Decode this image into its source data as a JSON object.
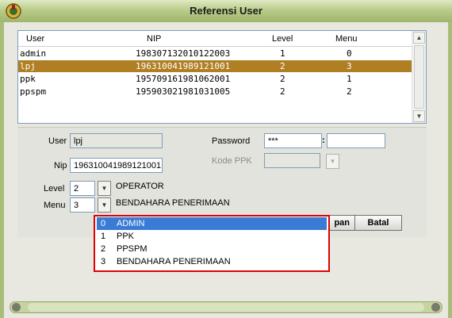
{
  "window": {
    "title": "Referensi User",
    "logo_icon": "emblem-icon"
  },
  "grid": {
    "columns": [
      "User",
      "NIP",
      "Level",
      "Menu"
    ],
    "rows": [
      {
        "user": "admin",
        "nip": "198307132010122003",
        "level": "1",
        "menu": "0",
        "selected": false
      },
      {
        "user": "lpj",
        "nip": "196310041989121001",
        "level": "2",
        "menu": "3",
        "selected": true
      },
      {
        "user": "ppk",
        "nip": "195709161981062001",
        "level": "2",
        "menu": "1",
        "selected": false
      },
      {
        "user": "ppspm",
        "nip": "195903021981031005",
        "level": "2",
        "menu": "2",
        "selected": false
      }
    ],
    "selected_color": "#b07f24"
  },
  "form": {
    "user_label": "User",
    "user_value": "lpj",
    "nip_label": "Nip",
    "nip_value": "196310041989121001",
    "level_label": "Level",
    "level_value": "2",
    "level_text": "OPERATOR",
    "menu_label": "Menu",
    "menu_value": "3",
    "menu_text": "BENDAHARA PENERIMAAN",
    "password_label": "Password",
    "password_value": "***",
    "password_separator": ":",
    "kode_ppk_label": "Kode PPK"
  },
  "buttons": {
    "save_partial": "pan",
    "cancel": "Batal"
  },
  "dropdown": {
    "items": [
      {
        "code": "0",
        "label": "ADMIN",
        "selected": true
      },
      {
        "code": "1",
        "label": "PPK",
        "selected": false
      },
      {
        "code": "2",
        "label": "PPSPM",
        "selected": false
      },
      {
        "code": "3",
        "label": "BENDAHARA PENERIMAAN",
        "selected": false
      }
    ],
    "highlight_color": "#e00000",
    "selection_color": "#3a7bd5"
  }
}
